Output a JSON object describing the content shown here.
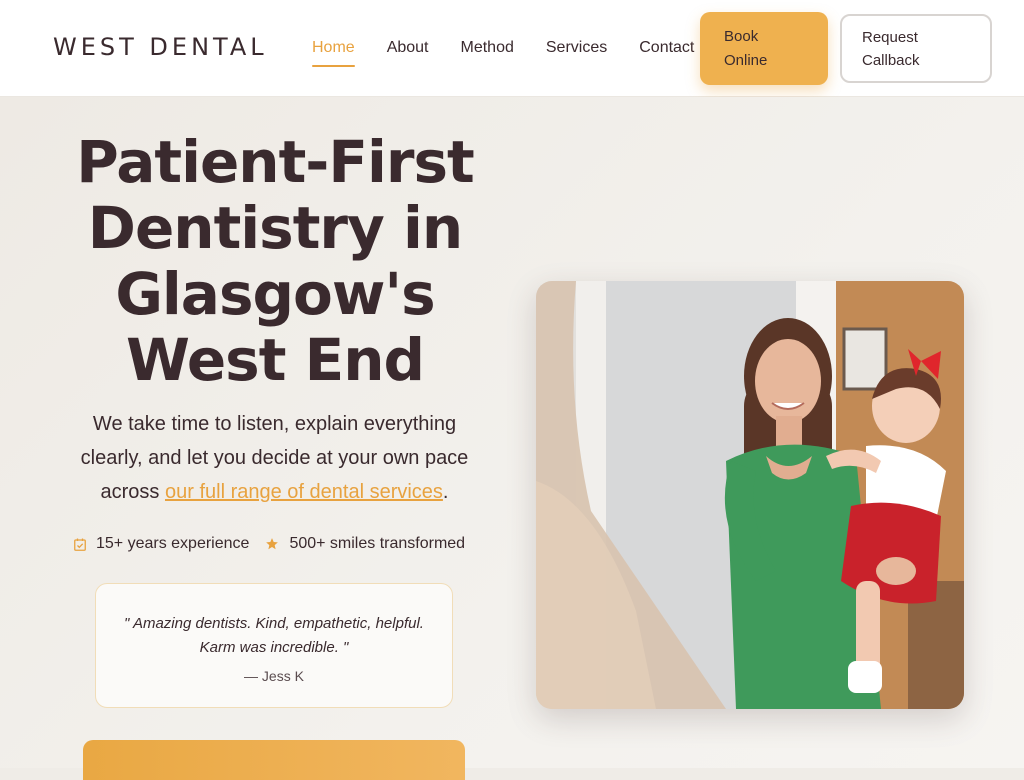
{
  "brand": {
    "name": "WEST DENTAL"
  },
  "nav": {
    "items": [
      {
        "label": "Home",
        "active": true
      },
      {
        "label": "About",
        "active": false
      },
      {
        "label": "Method",
        "active": false
      },
      {
        "label": "Services",
        "active": false
      },
      {
        "label": "Contact",
        "active": false
      }
    ],
    "book_label": "Book Online",
    "callback_label": "Request Callback"
  },
  "hero": {
    "title_lines": [
      "Patient-First",
      "Dentistry in",
      "Glasgow's",
      "West End"
    ],
    "text_before": "We take time to listen, explain everything clearly, and let you decide at your own pace across ",
    "text_link": "our full range of dental services",
    "text_after": ".",
    "stats": [
      {
        "icon": "calendar-check-icon",
        "label": "15+ years experience"
      },
      {
        "icon": "star-icon",
        "label": "500+ smiles transformed"
      }
    ],
    "testimonial": {
      "quote": "\" Amazing dentists. Kind, empathetic, helpful. Karm was incredible. \"",
      "author": "— Jess K"
    },
    "photo": {
      "icon": "mother-and-baby-photo"
    }
  },
  "colors": {
    "accent": "#e8a23f",
    "button_bg": "#efb14f",
    "text": "#3a2a2e",
    "background": "#efece7"
  }
}
